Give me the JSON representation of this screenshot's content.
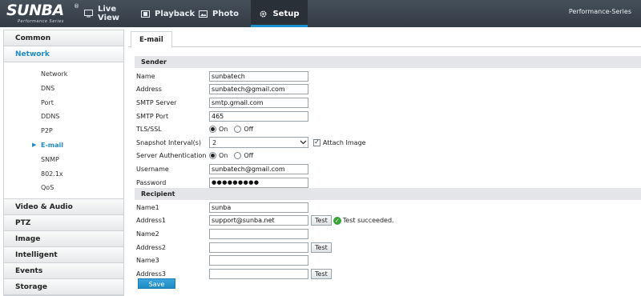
{
  "header": {
    "logo": "SUNBA",
    "logo_mark": "®",
    "logo_sub": "Performance Series",
    "nav": [
      {
        "label": "Live View",
        "icon": "monitor-icon"
      },
      {
        "label": "Playback",
        "icon": "film-icon"
      },
      {
        "label": "Photo",
        "icon": "photo-icon"
      },
      {
        "label": "Setup",
        "icon": "gear-icon"
      }
    ],
    "active_nav": "Setup",
    "series": "Performance-Series",
    "accent_color": "#1a8fd0"
  },
  "sidebar": {
    "categories": [
      {
        "label": "Common"
      },
      {
        "label": "Network",
        "active": true,
        "items": [
          "Network",
          "DNS",
          "Port",
          "DDNS",
          "P2P",
          "E-mail",
          "SNMP",
          "802.1x",
          "QoS"
        ],
        "active_item": "E-mail"
      },
      {
        "label": "Video & Audio"
      },
      {
        "label": "PTZ"
      },
      {
        "label": "Image"
      },
      {
        "label": "Intelligent"
      },
      {
        "label": "Events"
      },
      {
        "label": "Storage"
      }
    ]
  },
  "main": {
    "tab": "E-mail",
    "sender": {
      "title": "Sender",
      "name_label": "Name",
      "name_value": "sunbatech",
      "address_label": "Address",
      "address_value": "sunbatech@gmail.com",
      "smtp_server_label": "SMTP Server",
      "smtp_server_value": "smtp.gmail.com",
      "smtp_port_label": "SMTP Port",
      "smtp_port_value": "465",
      "tls_label": "TLS/SSL",
      "tls_on": "On",
      "tls_off": "Off",
      "tls_selected": "On",
      "interval_label": "Snapshot Interval(s)",
      "interval_value": "2",
      "attach_label": "Attach Image",
      "attach_checked": true,
      "auth_label": "Server Authentication",
      "auth_on": "On",
      "auth_off": "Off",
      "auth_selected": "On",
      "username_label": "Username",
      "username_value": "sunbatech@gmail.com",
      "password_label": "Password",
      "password_value": "●●●●●●●●●"
    },
    "recipient": {
      "title": "Recipient",
      "name1_label": "Name1",
      "name1_value": "sunba",
      "address1_label": "Address1",
      "address1_value": "support@sunba.net",
      "name2_label": "Name2",
      "name2_value": "",
      "address2_label": "Address2",
      "address2_value": "",
      "name3_label": "Name3",
      "name3_value": "",
      "address3_label": "Address3",
      "address3_value": "",
      "test_label": "Test",
      "test_result": "Test succeeded.",
      "success_color": "#3aa43a"
    },
    "save_label": "Save"
  }
}
